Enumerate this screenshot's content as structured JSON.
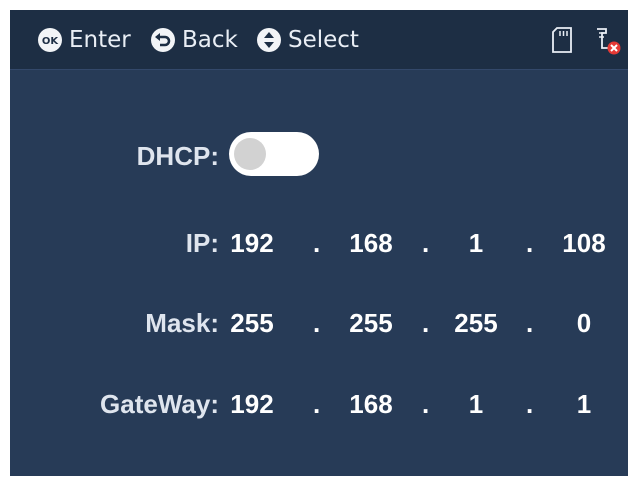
{
  "header": {
    "hints": [
      {
        "icon": "ok-icon",
        "label": "Enter"
      },
      {
        "icon": "back-icon",
        "label": "Back"
      },
      {
        "icon": "up-down-icon",
        "label": "Select"
      }
    ],
    "status_icons": [
      "sd-card-icon",
      "network-disconnected-icon"
    ]
  },
  "form": {
    "dhcp": {
      "label": "DHCP:",
      "enabled": false
    },
    "ip": {
      "label": "IP:",
      "octets": [
        "192",
        "168",
        "1",
        "108"
      ]
    },
    "mask": {
      "label": "Mask:",
      "octets": [
        "255",
        "255",
        "255",
        "0"
      ]
    },
    "gateway": {
      "label": "GateWay:",
      "octets": [
        "192",
        "168",
        "1",
        "1"
      ]
    },
    "separator": "."
  },
  "colors": {
    "background": "#273b57",
    "header": "#1d2e44",
    "text": "#ffffff",
    "error": "#e53935"
  }
}
